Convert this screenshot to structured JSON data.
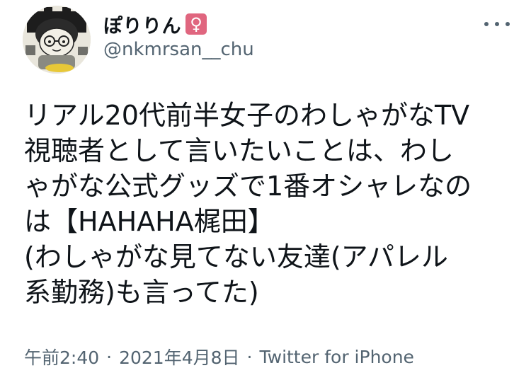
{
  "user": {
    "display_name": "ぽりりん",
    "badge_symbol": "♀",
    "badge_color": "#e0667f",
    "handle": "@nkmrsan__chu",
    "avatar_icon": "cartoon-avatar"
  },
  "menu": {
    "more_icon": "more-options-icon"
  },
  "tweet": {
    "lines": [
      "リアル20代前半女子のわしゃがなTV",
      "視聴者として言いたいことは、わし",
      "ゃがな公式グッズで1番オシャレなの",
      "は【HAHAHA梶田】",
      "(わしゃがな見てない友達(アパレル",
      "系勤務)も言ってた)"
    ]
  },
  "meta": {
    "time": "午前2:40",
    "separator": "·",
    "date": "2021年4月8日",
    "source": "Twitter for iPhone"
  },
  "colors": {
    "text": "#0f1419",
    "secondary": "#536471",
    "background": "#ffffff"
  }
}
